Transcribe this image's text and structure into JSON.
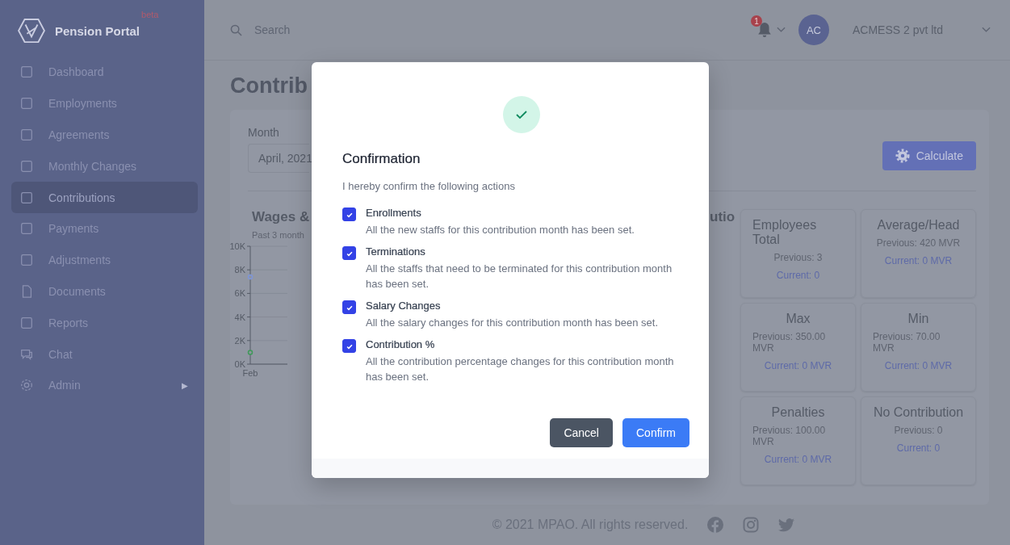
{
  "sidebar": {
    "brand": "Pension Portal",
    "badge": "beta",
    "items": [
      {
        "label": "Dashboard",
        "selected": false
      },
      {
        "label": "Employments",
        "selected": false
      },
      {
        "label": "Agreements",
        "selected": false
      },
      {
        "label": "Monthly Changes",
        "selected": false
      },
      {
        "label": "Contributions",
        "selected": true
      },
      {
        "label": "Payments",
        "selected": false
      },
      {
        "label": "Adjustments",
        "selected": false
      },
      {
        "label": "Documents",
        "selected": false
      },
      {
        "label": "Reports",
        "selected": false
      },
      {
        "label": "Chat",
        "selected": false
      },
      {
        "label": "Admin",
        "selected": false,
        "arrow": "▶"
      }
    ]
  },
  "topbar": {
    "search": {
      "placeholder": "Search"
    },
    "notification_count": "1",
    "avatar": "AC",
    "company": "ACMESS 2 pvt ltd"
  },
  "page": {
    "title": "Contrib",
    "month": {
      "label": "Month",
      "value": "April, 2021"
    },
    "calculate_button": "Calculate",
    "chart": {
      "title": "Wages &",
      "subtitle": "Past 3 month",
      "chart_data": {
        "type": "line",
        "categories": [
          "Feb"
        ],
        "ylim": [
          0,
          10000
        ],
        "grid": true,
        "yticks": [
          {
            "value": 0,
            "label": "0K"
          },
          {
            "value": 2000,
            "label": "2K"
          },
          {
            "value": 4000,
            "label": "4K"
          },
          {
            "value": 6000,
            "label": "6K"
          },
          {
            "value": 8000,
            "label": "8K"
          },
          {
            "value": 10000,
            "label": "10K"
          }
        ],
        "series": [
          {
            "color": "#7e96d8",
            "values": [
              7400
            ],
            "marker": true
          },
          {
            "color": "#3f9a5a",
            "values": [
              1000
            ],
            "marker": true
          }
        ]
      }
    },
    "section_title": "utio",
    "stats": [
      {
        "title": "Employees Total",
        "previous": "Previous: 3",
        "current": "Current: 0"
      },
      {
        "title": "Average/Head",
        "previous": "Previous: 420 MVR",
        "current": "Current: 0 MVR"
      },
      {
        "title": "Max",
        "previous": "Previous: 350.00 MVR",
        "current": "Current: 0 MVR"
      },
      {
        "title": "Min",
        "previous": "Previous: 70.00 MVR",
        "current": "Current: 0 MVR"
      },
      {
        "title": "Penalties",
        "previous": "Previous: 100.00 MVR",
        "current": "Current: 0 MVR"
      },
      {
        "title": "No Contribution",
        "previous": "Previous: 0",
        "current": "Current: 0"
      }
    ]
  },
  "modal": {
    "title": "Confirmation",
    "intro": "I hereby confirm the following actions",
    "items": [
      {
        "label": "Enrollments",
        "description": "All the new staffs for this contribution month has been set.",
        "checked": true
      },
      {
        "label": "Terminations",
        "description": "All the staffs that need to be terminated for this contribution month has been set.",
        "checked": true
      },
      {
        "label": "Salary Changes",
        "description": "All the salary changes for this contribution month has been set.",
        "checked": true
      },
      {
        "label": "Contribution %",
        "description": "All the contribution percentage changes for this contribution month has been set.",
        "checked": true
      }
    ],
    "cancel": "Cancel",
    "confirm": "Confirm"
  },
  "footer": {
    "copyright": "© 2021 MPAO. All rights reserved."
  }
}
